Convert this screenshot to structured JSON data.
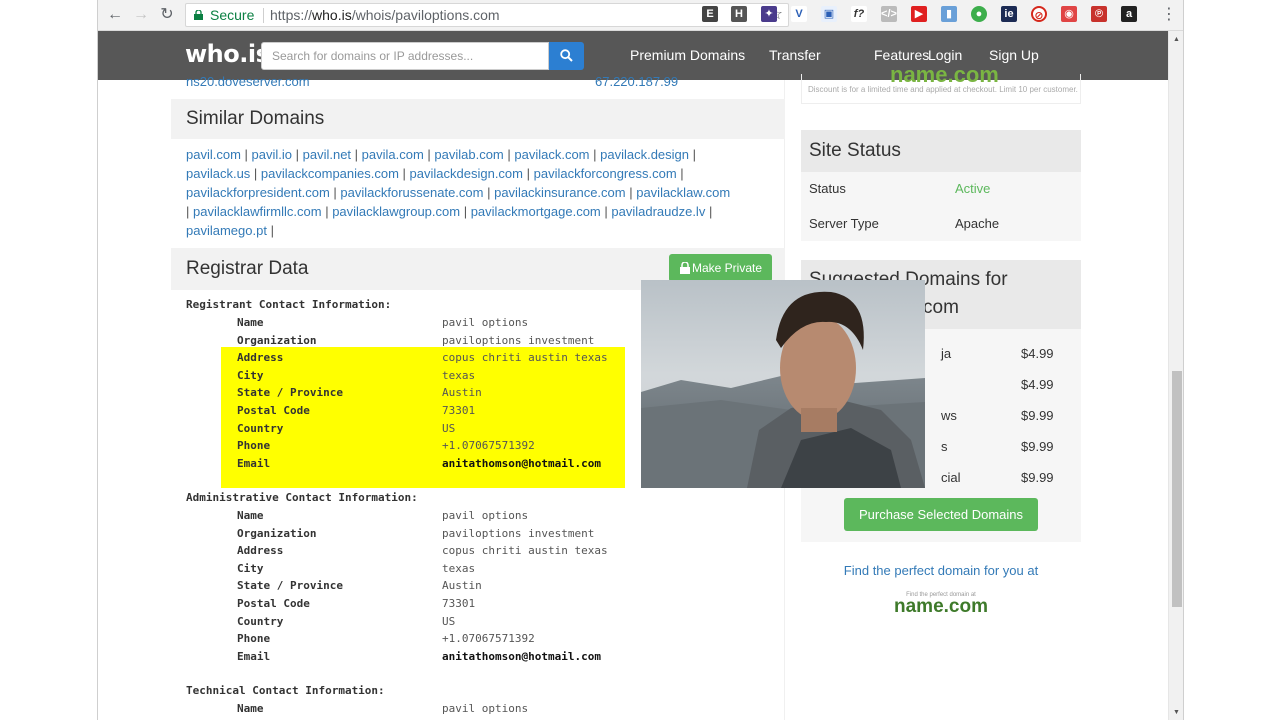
{
  "browser": {
    "secure_label": "Secure",
    "url_prefix": "https://",
    "url_host": "who.is",
    "url_path": "/whois/paviloptions.com"
  },
  "header": {
    "logo": "who.is",
    "search_placeholder": "Search for domains or IP addresses...",
    "nav": [
      "Premium Domains",
      "Transfer",
      "Features",
      "Login",
      "Sign Up"
    ]
  },
  "nameserver": {
    "host": "ns20.doveserver.com",
    "ip": "67.220.187.99"
  },
  "similar": {
    "title": "Similar Domains",
    "domains": [
      "pavil.com",
      "pavil.io",
      "pavil.net",
      "pavila.com",
      "pavilab.com",
      "pavilack.com",
      "pavilack.design",
      "pavilack.us",
      "pavilackcompanies.com",
      "pavilackdesign.com",
      "pavilackforcongress.com",
      "pavilackforpresident.com",
      "pavilackforussenate.com",
      "pavilackinsurance.com",
      "pavilacklaw.com",
      "pavilacklawfirmllc.com",
      "pavilacklawgroup.com",
      "pavilackmortgage.com",
      "paviladraudze.lv",
      "pavilamego.pt"
    ]
  },
  "registrar": {
    "title": "Registrar Data",
    "make_private": "Make Private",
    "registrant": {
      "heading": "Registrant Contact Information:",
      "rows": [
        {
          "label": "Name",
          "value": "pavil options"
        },
        {
          "label": "Organization",
          "value": "paviloptions investment"
        },
        {
          "label": "Address",
          "value": "copus chriti austin texas"
        },
        {
          "label": "City",
          "value": "texas"
        },
        {
          "label": "State / Province",
          "value": "Austin"
        },
        {
          "label": "Postal Code",
          "value": "73301"
        },
        {
          "label": "Country",
          "value": "US"
        },
        {
          "label": "Phone",
          "value": "+1.07067571392"
        },
        {
          "label": "Email",
          "value": "anitathomson@hotmail.com"
        }
      ]
    },
    "admin": {
      "heading": "Administrative Contact Information:",
      "rows": [
        {
          "label": "Name",
          "value": "pavil options"
        },
        {
          "label": "Organization",
          "value": "paviloptions investment"
        },
        {
          "label": "Address",
          "value": "copus chriti austin texas"
        },
        {
          "label": "City",
          "value": "texas"
        },
        {
          "label": "State / Province",
          "value": "Austin"
        },
        {
          "label": "Postal Code",
          "value": "73301"
        },
        {
          "label": "Country",
          "value": "US"
        },
        {
          "label": "Phone",
          "value": "+1.07067571392"
        },
        {
          "label": "Email",
          "value": "anitathomson@hotmail.com"
        }
      ]
    },
    "technical": {
      "heading": "Technical Contact Information:",
      "rows": [
        {
          "label": "Name",
          "value": "pavil options"
        }
      ]
    }
  },
  "sidebar": {
    "namecom_logo": "name.com",
    "disclaimer": "Discount is for a limited time and applied at checkout. Limit 10 per customer.",
    "site_status": {
      "title": "Site Status",
      "status_label": "Status",
      "status_value": "Active",
      "server_label": "Server Type",
      "server_value": "Apache"
    },
    "suggested": {
      "title_line1": "Suggested Domains for",
      "title_line2": "com",
      "items": [
        {
          "name": "ja",
          "price": "$4.99"
        },
        {
          "name": "",
          "price": "$4.99"
        },
        {
          "name": "ws",
          "price": "$9.99"
        },
        {
          "name": "s",
          "price": "$9.99"
        },
        {
          "name": "cial",
          "price": "$9.99"
        }
      ],
      "purchase": "Purchase Selected Domains"
    },
    "find_text": "Find the perfect domain for you at",
    "find_tiny": "Find the perfect domain at",
    "find_logo": "name.com"
  },
  "colors": {
    "highlight": "#ffff00",
    "link": "#337ab7",
    "active": "#5cb85c",
    "header_bg": "#575757"
  }
}
